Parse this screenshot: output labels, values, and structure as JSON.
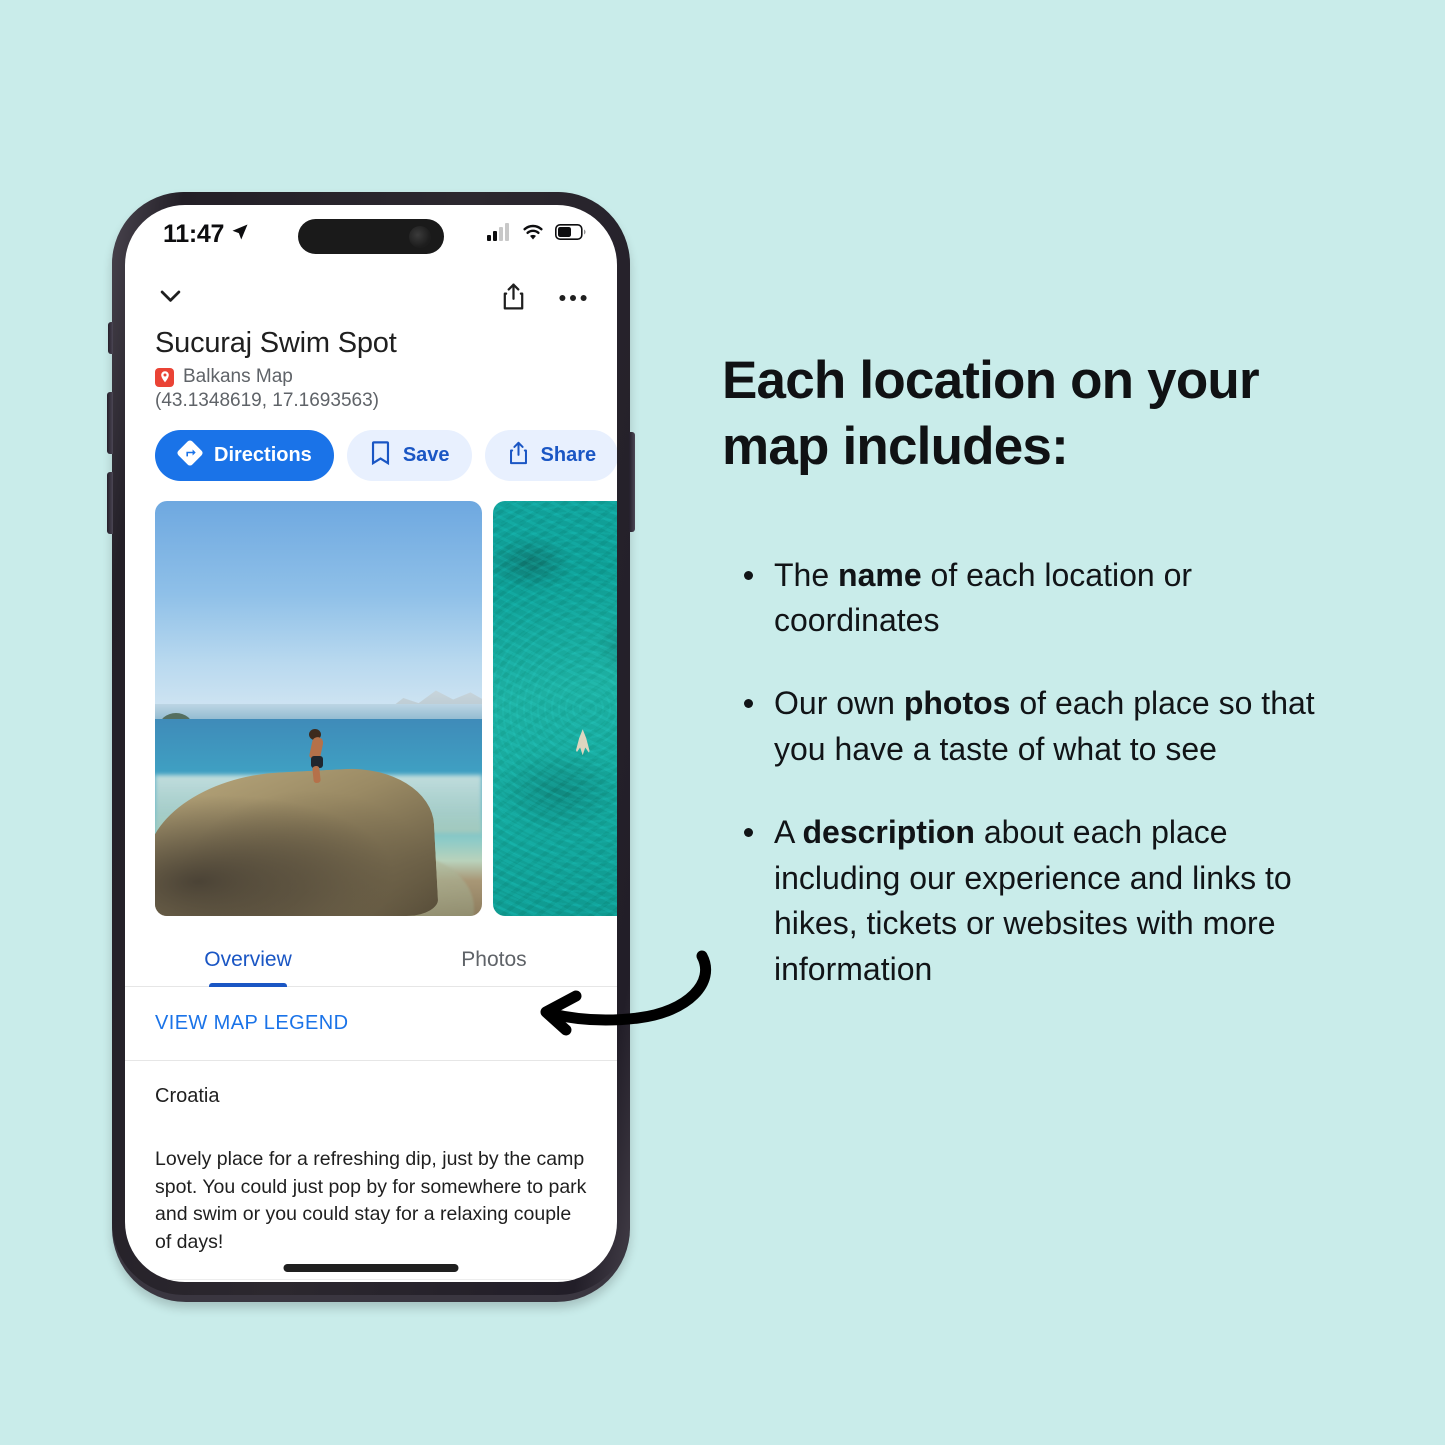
{
  "canvas": {
    "background_color": "#c9ecea"
  },
  "phone": {
    "status_bar": {
      "time": "11:47",
      "location_arrow_icon": "location-arrow-icon",
      "cellular_icon": "cellular-signal-icon",
      "wifi_icon": "wifi-icon",
      "battery_icon": "battery-icon"
    },
    "nav": {
      "collapse_icon": "chevron-down-icon",
      "share_icon": "share-icon",
      "more_icon": "more-options-icon"
    },
    "place": {
      "title": "Sucuraj Swim Spot",
      "map_badge_icon": "map-pin-icon",
      "map_name": "Balkans Map",
      "coordinates": "(43.1348619, 17.1693563)"
    },
    "actions": [
      {
        "label": "Directions",
        "icon": "directions-icon",
        "style": "primary"
      },
      {
        "label": "Save",
        "icon": "bookmark-icon",
        "style": "secondary"
      },
      {
        "label": "Share",
        "icon": "share-icon",
        "style": "secondary"
      }
    ],
    "photos": [
      {
        "alt": "swimmer diving from rocky shore into clear blue sea"
      },
      {
        "alt": "aerial view of turquoise water with a swimmer"
      }
    ],
    "tabs": [
      {
        "label": "Overview",
        "active": true
      },
      {
        "label": "Photos",
        "active": false
      }
    ],
    "legend_link": "VIEW MAP LEGEND",
    "country": "Croatia",
    "description": "Lovely place for a refreshing dip, just by the camp spot. You could just pop by for somewhere to park and swim or you could stay for a relaxing couple of days!",
    "bottom_photos": [
      {
        "alt": "sky and sea thumbnail"
      },
      {
        "alt": "turquoise water and rocks thumbnail"
      }
    ],
    "home_indicator": "home-indicator"
  },
  "annotation": {
    "arrow": "curved-arrow-pointing-left"
  },
  "right_panel": {
    "headline": "Each location on your map includes:",
    "bullets": [
      {
        "before": "The ",
        "strong": "name",
        "after": " of each location or coordinates"
      },
      {
        "before": "Our own ",
        "strong": "photos",
        "after": " of each place so that you have a taste of what to see"
      },
      {
        "before": "A ",
        "strong": "description",
        "after": " about each place including our experience and links to hikes, tickets or websites with more information"
      }
    ]
  },
  "colors": {
    "accent_blue": "#1a73e8",
    "accent_blue_dark": "#1a56c4",
    "chip_blue": "#e8f0fe",
    "pin_red": "#ea4335",
    "text_dark": "#1f1f1f",
    "text_muted": "#5f6368"
  }
}
